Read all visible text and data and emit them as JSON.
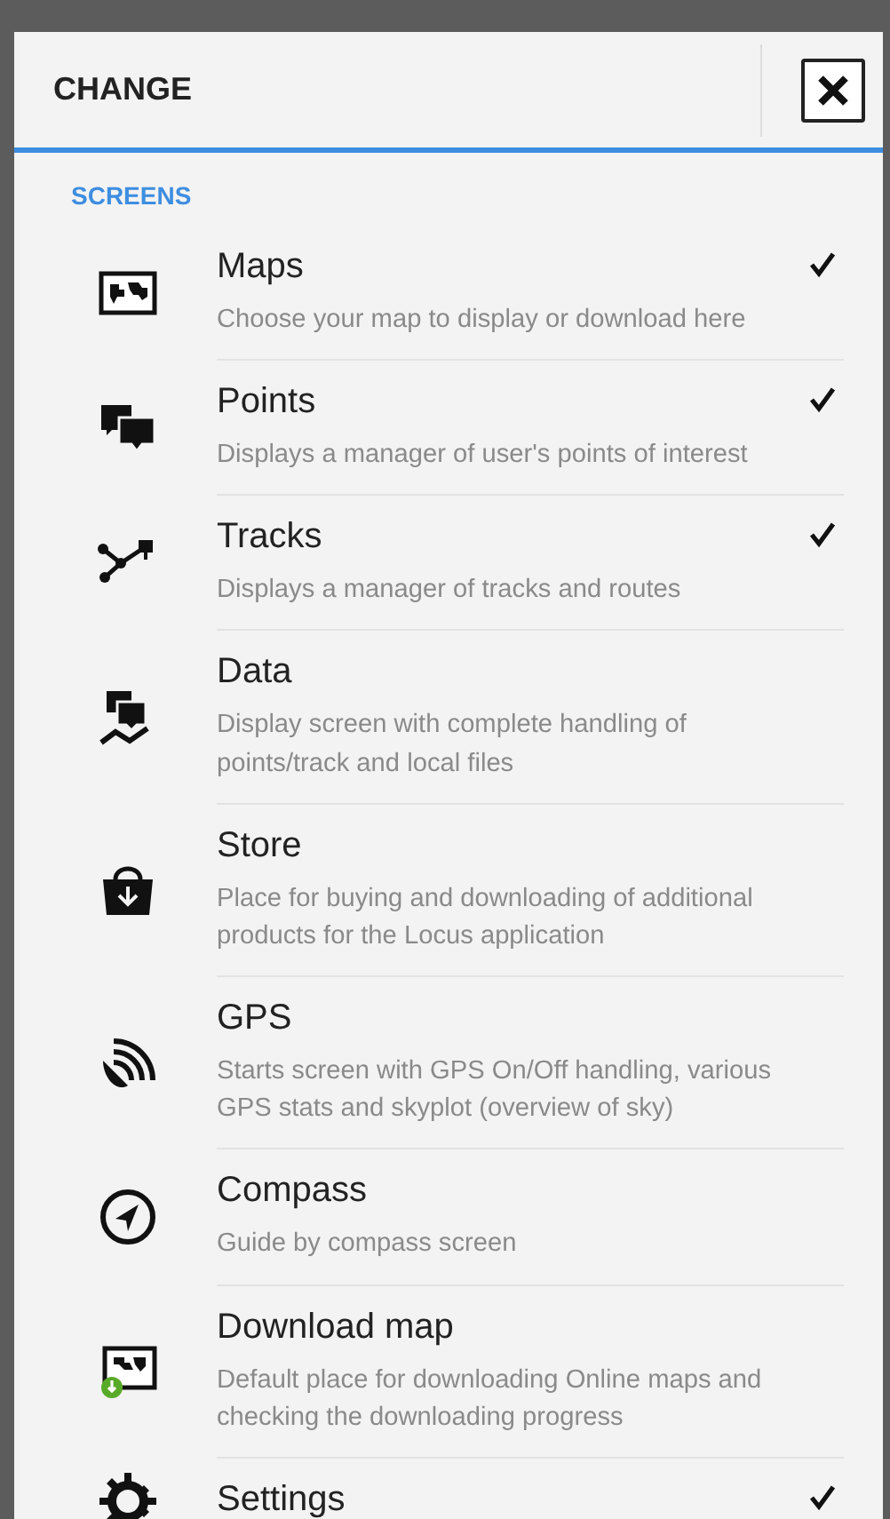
{
  "dialog": {
    "title": "CHANGE",
    "section": "SCREENS",
    "items": [
      {
        "title": "Maps",
        "description": "Choose your map to display or download here",
        "checked": true
      },
      {
        "title": "Points",
        "description": "Displays a manager of user's points of interest",
        "checked": true
      },
      {
        "title": "Tracks",
        "description": "Displays a manager of tracks and routes",
        "checked": true
      },
      {
        "title": "Data",
        "description": "Display screen with complete handling of points/track and local files",
        "checked": false
      },
      {
        "title": "Store",
        "description": "Place for buying and downloading of additional products for the Locus application",
        "checked": false
      },
      {
        "title": "GPS",
        "description": "Starts screen with GPS On/Off handling, various GPS stats and skyplot (overview of sky)",
        "checked": false
      },
      {
        "title": "Compass",
        "description": "Guide by compass screen",
        "checked": false
      },
      {
        "title": "Download map",
        "description": "Default place for downloading Online maps and checking the downloading progress",
        "checked": false
      },
      {
        "title": "Settings",
        "checked": true
      }
    ]
  }
}
